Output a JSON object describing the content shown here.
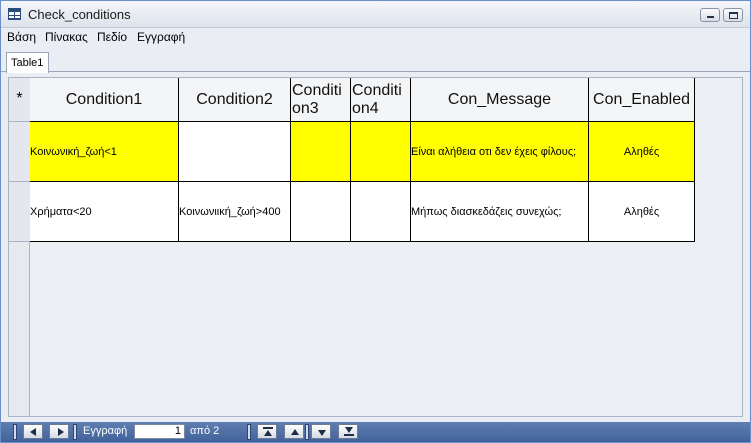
{
  "window": {
    "title": "Check_conditions"
  },
  "menu": {
    "items": [
      "Βάση",
      "Πίνακας",
      "Πεδίο",
      "Εγγραφή"
    ]
  },
  "tabs": [
    {
      "label": "Table1"
    }
  ],
  "grid": {
    "new_row_marker": "*",
    "columns": [
      "Condition1",
      "Condition2",
      "Conditi on3",
      "Conditi on4",
      "Con_Message",
      "Con_Enabled"
    ],
    "column_display": {
      "c3_line1": "Conditi",
      "c3_line2": "on3",
      "c4_line1": "Conditi",
      "c4_line2": "on4"
    },
    "rows": [
      {
        "condition1": "Κοινωνική_ζωή<1",
        "condition2": "",
        "condition3": "",
        "condition4": "",
        "con_message": "Είναι αλήθεια οτι δεν έχεις φίλους;",
        "con_enabled": "Αληθές",
        "highlight": "#ffff00"
      },
      {
        "condition1": "Χρήματα<20",
        "condition2": "Κοινωνιική_ζωή>400",
        "condition3": "",
        "condition4": "",
        "con_message": "Μήπως διασκεδάζεις συνεχώς;",
        "con_enabled": "Αληθές",
        "highlight": "#ffffff"
      }
    ]
  },
  "navigation": {
    "record_label": "Εγγραφή",
    "current_record": "1",
    "of_label": "από 2"
  },
  "colors": {
    "selected_row": "#ffff00",
    "nav_bar": "#4f6ea5",
    "window_border": "#6a8fc8"
  },
  "icons": {
    "title": "table-icon",
    "minimize": "minimize-icon",
    "maximize": "maximize-icon",
    "nav_prev": "previous-record-icon",
    "nav_next": "next-record-icon",
    "nav_first": "first-record-icon",
    "nav_up": "scroll-up-icon",
    "nav_down": "scroll-down-icon",
    "nav_last": "last-record-icon"
  }
}
